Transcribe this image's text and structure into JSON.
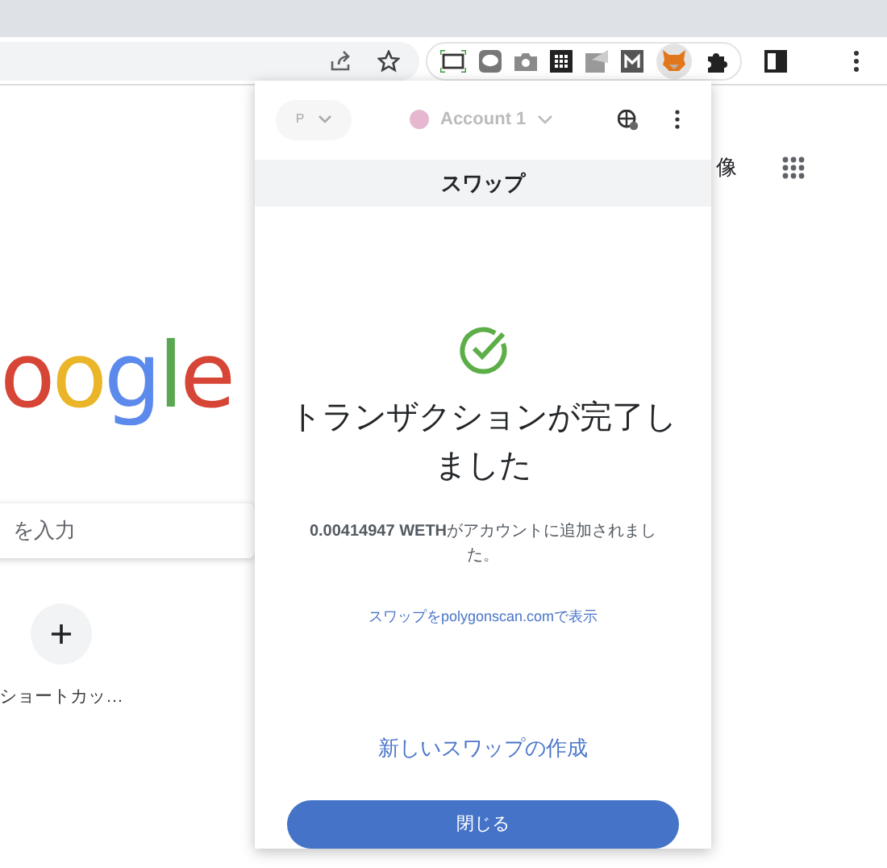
{
  "new_tab": {
    "logo": "oogle",
    "search_placeholder": "を入力",
    "images_link": "像",
    "shortcut": {
      "label": "ショートカッ…"
    }
  },
  "popup": {
    "network": "P",
    "account": "Account 1",
    "title": "スワップ",
    "heading": "トランザクションが完了しました",
    "message": "**0.00414947 WETH**がアカウントに追加されました。",
    "explorer_link": "スワップをpolygonscan.comで表示",
    "new_swap_link": "新しいスワップの作成",
    "close_button": "閉じる"
  }
}
